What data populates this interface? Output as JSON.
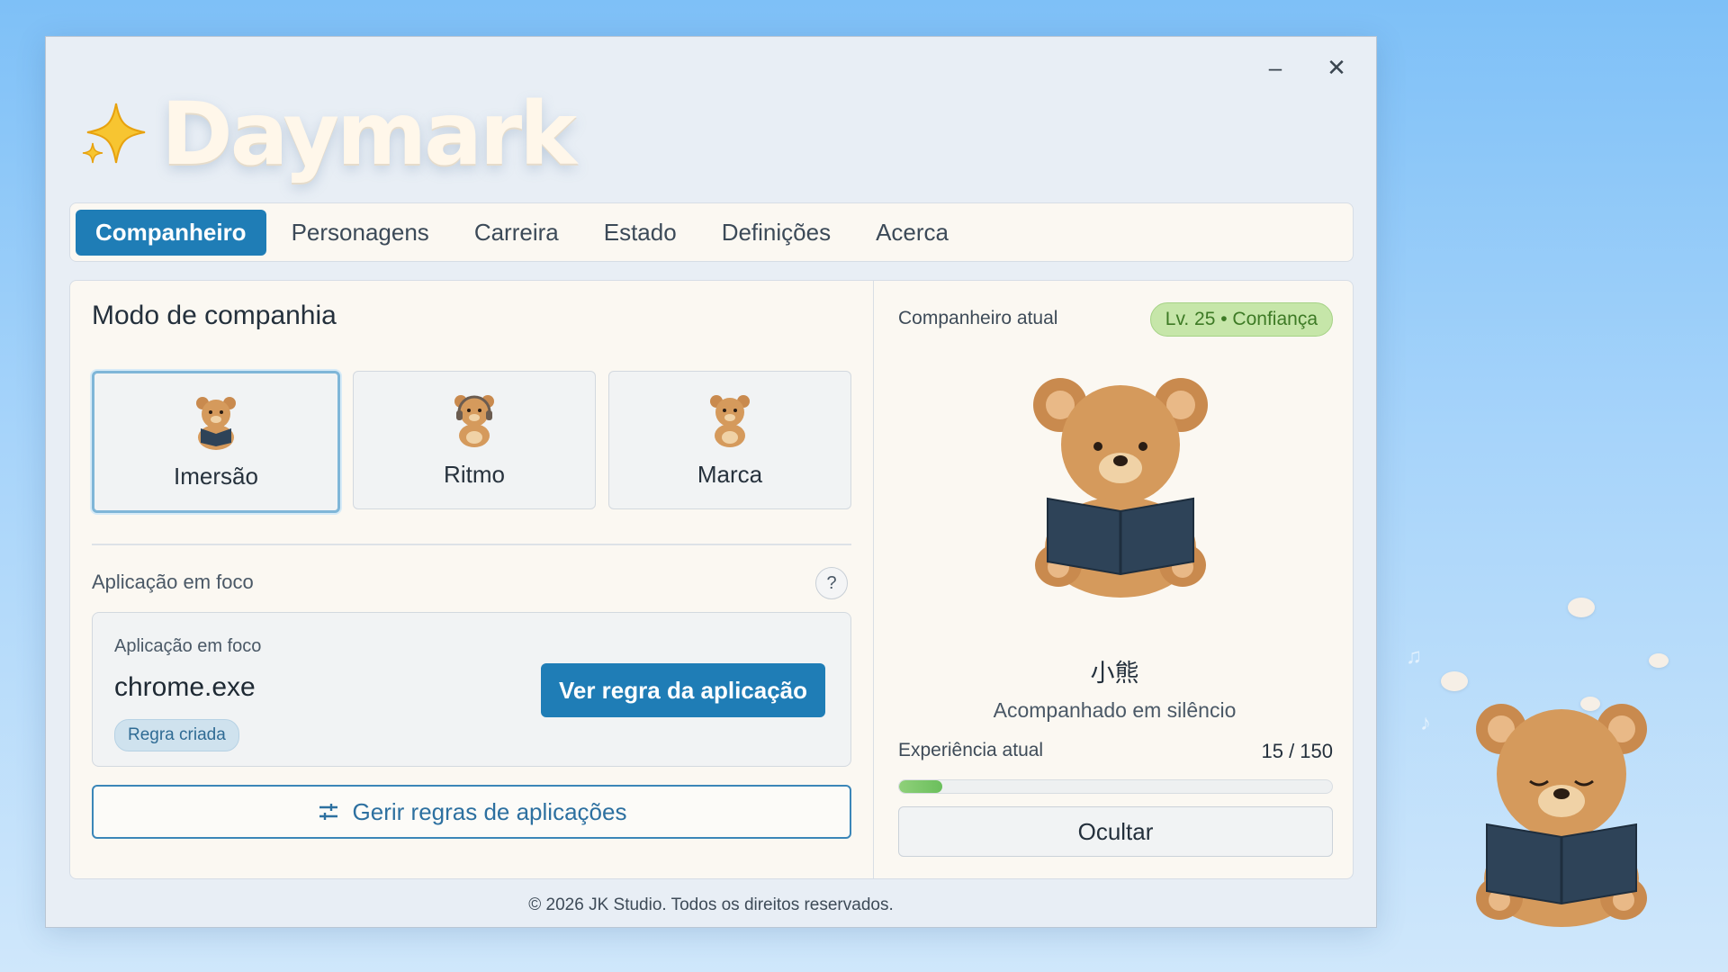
{
  "app": {
    "title": "Daymark"
  },
  "window": {
    "minimize_symbol": "–",
    "close_symbol": "✕"
  },
  "tabs": [
    {
      "label": "Companheiro",
      "active": true
    },
    {
      "label": "Personagens"
    },
    {
      "label": "Carreira"
    },
    {
      "label": "Estado"
    },
    {
      "label": "Definições"
    },
    {
      "label": "Acerca"
    }
  ],
  "mode": {
    "title": "Modo de companhia",
    "options": [
      {
        "label": "Imersão",
        "icon": "bear-reading-icon",
        "selected": true
      },
      {
        "label": "Ritmo",
        "icon": "bear-headphones-icon"
      },
      {
        "label": "Marca",
        "icon": "bear-icon"
      }
    ]
  },
  "focus": {
    "heading": "Aplicação em foco",
    "help": "?",
    "card_label": "Aplicação em foco",
    "app_name": "chrome.exe",
    "badge": "Regra criada",
    "view_rule_button": "Ver regra da aplicação"
  },
  "manage_button": "Gerir regras de aplicações",
  "companion": {
    "label": "Companheiro atual",
    "level_badge": "Lv. 25 • Confiança",
    "name": "小熊",
    "status": "Acompanhado em silêncio",
    "xp_label": "Experiência atual",
    "xp_text": "15 / 150",
    "xp_current": 15,
    "xp_max": 150,
    "hide_button": "Ocultar"
  },
  "footer": "© 2026 JK Studio. Todos os direitos reservados.",
  "colors": {
    "accent": "#1f7db6",
    "level_green": "#c6e6a9",
    "bear": "#d59a5c"
  }
}
